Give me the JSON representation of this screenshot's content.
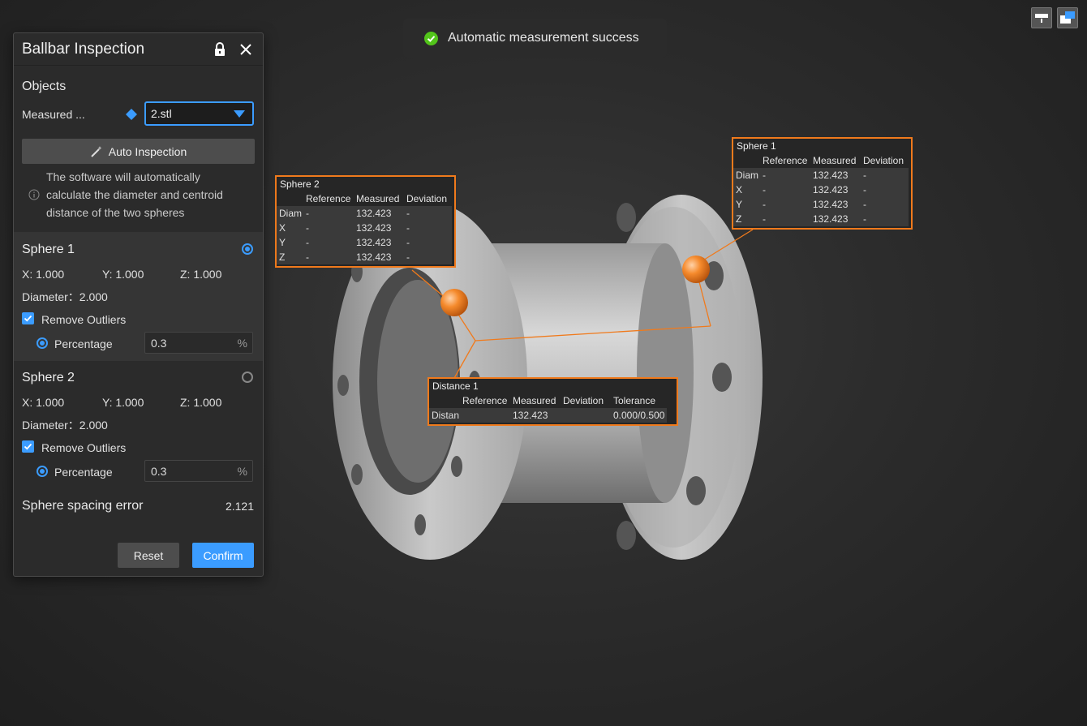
{
  "panel": {
    "title": "Ballbar Inspection",
    "objects_label": "Objects",
    "measured_label": "Measured ...",
    "measured_value": "2.stl",
    "auto_inspection_label": "Auto Inspection",
    "info_text": "The software will automatically calculate the diameter and centroid distance of the two spheres",
    "sphere1": {
      "title": "Sphere 1",
      "x": "X: 1.000",
      "y": "Y: 1.000",
      "z": "Z: 1.000",
      "diameter": "Diameter：2.000",
      "remove_outliers": "Remove Outliers",
      "percentage_label": "Percentage",
      "percentage_value": "0.3",
      "unit": "%"
    },
    "sphere2": {
      "title": "Sphere 2",
      "x": "X: 1.000",
      "y": "Y: 1.000",
      "z": "Z: 1.000",
      "diameter": "Diameter：2.000",
      "remove_outliers": "Remove Outliers",
      "percentage_label": "Percentage",
      "percentage_value": "0.3",
      "unit": "%"
    },
    "spacing_error_label": "Sphere spacing error",
    "spacing_error_value": "2.121",
    "reset_label": "Reset",
    "confirm_label": "Confirm"
  },
  "toast": {
    "message": "Automatic measurement success"
  },
  "annotations": {
    "sphere2": {
      "title": "Sphere 2",
      "headers": [
        "Reference",
        "Measured",
        "Deviation"
      ],
      "rows": [
        [
          "Diam",
          "-",
          "132.423",
          "-"
        ],
        [
          "X",
          "-",
          "132.423",
          "-"
        ],
        [
          "Y",
          "-",
          "132.423",
          "-"
        ],
        [
          "Z",
          "-",
          "132.423",
          "-"
        ]
      ]
    },
    "sphere1": {
      "title": "Sphere 1",
      "headers": [
        "Reference",
        "Measured",
        "Deviation"
      ],
      "rows": [
        [
          "Diam",
          "-",
          "132.423",
          "-"
        ],
        [
          "X",
          "-",
          "132.423",
          "-"
        ],
        [
          "Y",
          "-",
          "132.423",
          "-"
        ],
        [
          "Z",
          "-",
          "132.423",
          "-"
        ]
      ]
    },
    "distance1": {
      "title": "Distance 1",
      "headers": [
        "Reference",
        "Measured",
        "Deviation",
        "Tolerance"
      ],
      "rows": [
        [
          "Distan",
          "",
          "132.423",
          "",
          "0.000/0.500"
        ]
      ]
    }
  },
  "colors": {
    "accent": "#3b9cff",
    "annotation": "#f07a1c",
    "success": "#52c41a"
  }
}
